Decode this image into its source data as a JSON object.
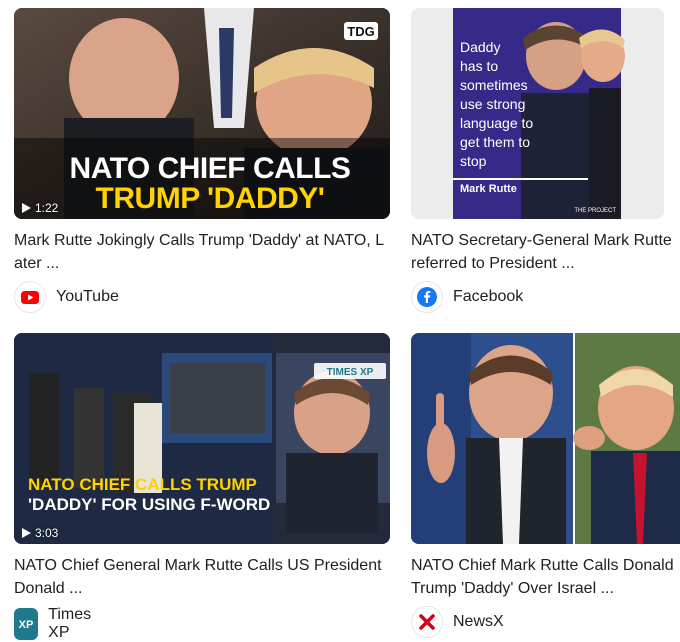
{
  "results": [
    {
      "title": "Mark Rutte Jokingly Calls Trump 'Daddy' at NATO, Later ...",
      "duration": "1:22",
      "source": "YouTube",
      "source_icon": "youtube-icon",
      "overlay_line1": "NATO CHIEF CALLS",
      "overlay_line2": "TRUMP 'DADDY'",
      "badge": "TDG"
    },
    {
      "title": "NATO Secretary-General Mark Rutte referred to President ...",
      "source": "Facebook",
      "source_icon": "facebook-icon",
      "quote_lines": [
        "Daddy",
        "has to",
        "sometimes",
        "use strong",
        "language to",
        "get them to",
        "stop"
      ],
      "quote_author": "Mark Rutte",
      "badge": "THE PROJECT"
    },
    {
      "title": "NATO Chief General Mark Rutte Calls US President Donald ...",
      "duration": "3:03",
      "source": "Times XP",
      "source_icon": "times-xp-icon",
      "overlay_line1": "NATO CHIEF CALLS TRUMP",
      "overlay_line2": "'DADDY' FOR USING F-WORD",
      "badge": "TIMES XP"
    },
    {
      "title": "NATO Chief Mark Rutte Calls Donald Trump 'Daddy' Over Israel ...",
      "source": "NewsX",
      "source_icon": "newsx-icon"
    }
  ],
  "colors": {
    "youtube": "#ff0000",
    "facebook": "#1877f2",
    "timesxp": "#1f7a8c",
    "newsx": "#d0021b",
    "overlay_yellow": "#ffd200"
  }
}
